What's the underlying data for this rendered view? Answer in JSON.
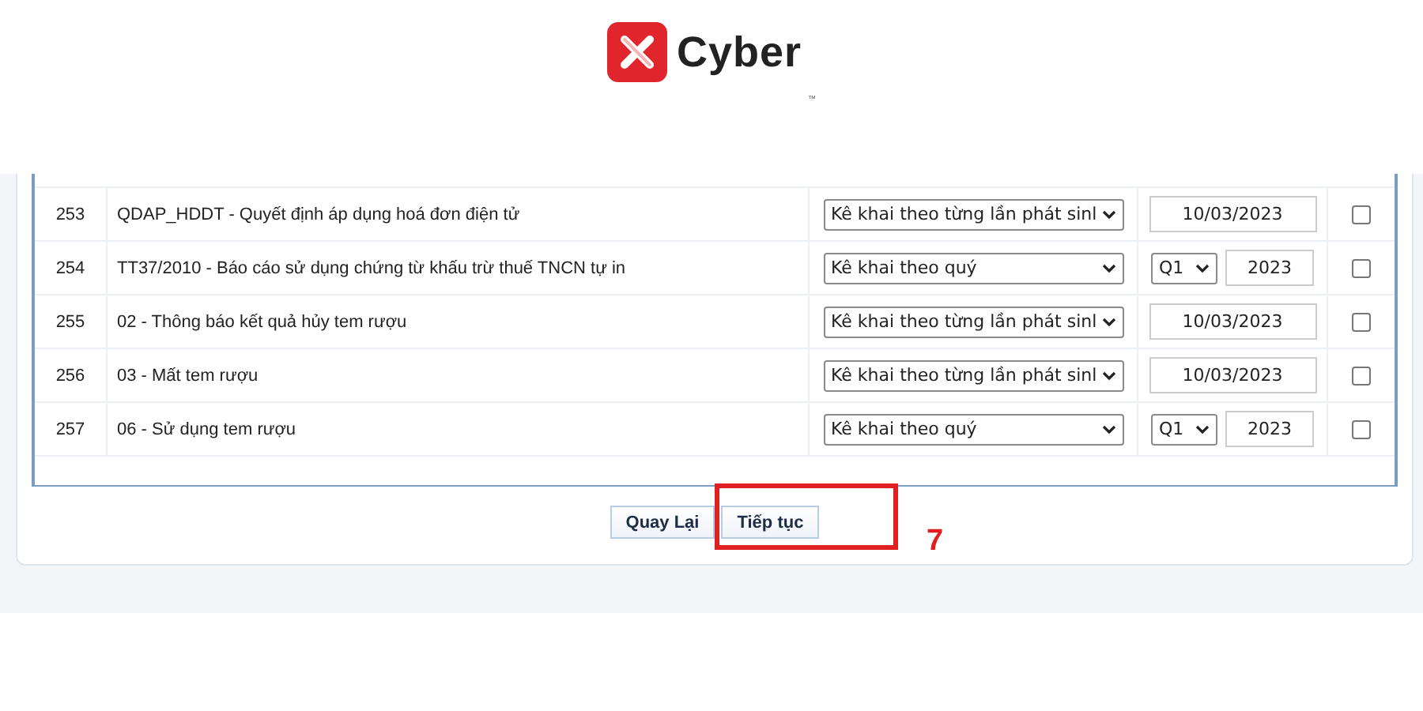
{
  "logo": {
    "name": "Cyber",
    "trademark": "™"
  },
  "rows": [
    {
      "number": "253",
      "name": "QDAP_HDDT - Quyết định áp dụng hoá đơn điện tử",
      "period": "Kê khai theo từng lần phát sinl",
      "kind": "date",
      "date": "10/03/2023",
      "checked": false
    },
    {
      "number": "254",
      "name": "TT37/2010 - Báo cáo sử dụng chứng từ khấu trừ thuế TNCN tự in",
      "period": "Kê khai theo quý",
      "kind": "quarter",
      "quarter": "Q1",
      "year": "2023",
      "checked": false
    },
    {
      "number": "255",
      "name": "02 - Thông báo kết quả hủy tem rượu",
      "period": "Kê khai theo từng lần phát sinl",
      "kind": "date",
      "date": "10/03/2023",
      "checked": false
    },
    {
      "number": "256",
      "name": "03 - Mất tem rượu",
      "period": "Kê khai theo từng lần phát sinl",
      "kind": "date",
      "date": "10/03/2023",
      "checked": false
    },
    {
      "number": "257",
      "name": "06 - Sử dụng tem rượu",
      "period": "Kê khai theo quý",
      "kind": "quarter",
      "quarter": "Q1",
      "year": "2023",
      "checked": false
    }
  ],
  "buttons": [
    {
      "label": "Quay Lại"
    },
    {
      "label": "Tiếp tục"
    }
  ],
  "callout": {
    "label": "7"
  }
}
